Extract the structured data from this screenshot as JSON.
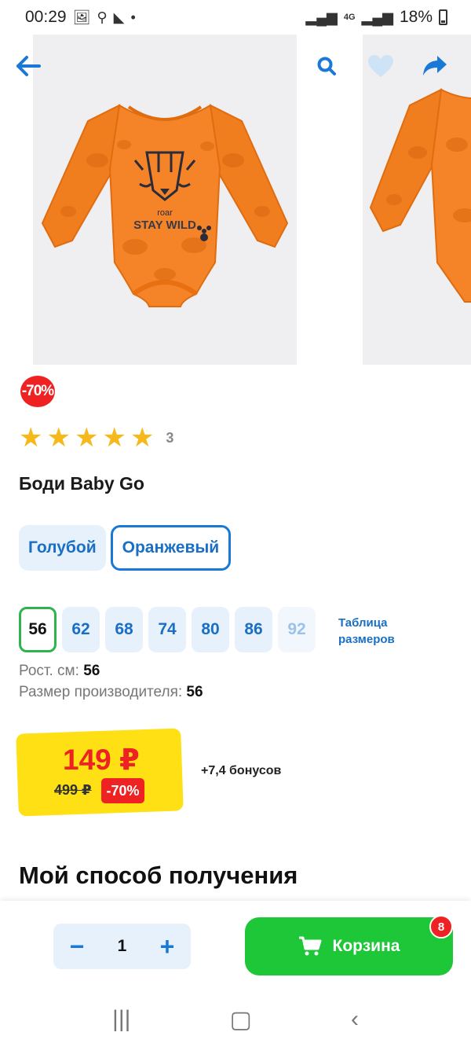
{
  "status_bar": {
    "time": "00:29",
    "battery": "18%",
    "network_label": "4G"
  },
  "gallery": {
    "print_text_top": "roar",
    "print_text_main": "STAY WILD"
  },
  "product": {
    "discount_badge": "-70%",
    "rating_count": "3",
    "rating_value": 5,
    "title": "Боди Baby Go"
  },
  "colors": [
    {
      "label": "Голубой",
      "selected": false
    },
    {
      "label": "Оранжевый",
      "selected": true
    }
  ],
  "sizes": [
    {
      "label": "56",
      "state": "selected"
    },
    {
      "label": "62",
      "state": "available"
    },
    {
      "label": "68",
      "state": "available"
    },
    {
      "label": "74",
      "state": "available"
    },
    {
      "label": "80",
      "state": "available"
    },
    {
      "label": "86",
      "state": "available"
    },
    {
      "label": "92",
      "state": "disabled"
    }
  ],
  "size_table_link": "Таблица размеров",
  "size_info": {
    "height_label": "Рост. см:",
    "height_value": "56",
    "maker_label": "Размер производителя:",
    "maker_value": "56"
  },
  "price": {
    "current": "149 ₽",
    "old": "499 ₽",
    "discount": "-70%",
    "bonus": "+7,4 бонусов"
  },
  "delivery_section_title": "Мой способ получения",
  "action_bar": {
    "quantity": "1",
    "cart_label": "Корзина",
    "cart_count": "8"
  },
  "colors_theme": {
    "accent": "#1a78d6",
    "sale_red": "#ee2222",
    "price_yellow": "#ffe014",
    "cart_green": "#1dc738",
    "product_orange": "#f07e1e"
  }
}
